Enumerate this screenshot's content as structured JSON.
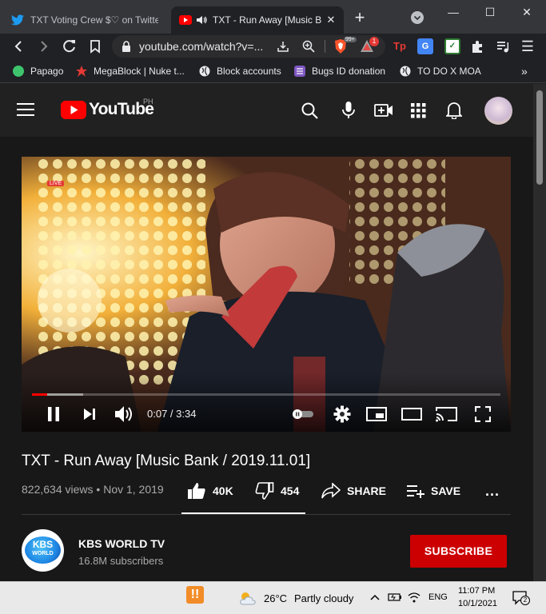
{
  "browser": {
    "tabs": [
      {
        "title": "TXT Voting Crew $♡ on Twitter: \"",
        "active": false
      },
      {
        "title": "TXT - Run Away [Music Bank",
        "active": true
      }
    ],
    "url": "youtube.com/watch?v=...",
    "extension_badge": "1",
    "brave_badge": "99+",
    "bookmarks": [
      {
        "label": "Papago",
        "icon": "papago-icon",
        "color": "#3ec46d"
      },
      {
        "label": "MegaBlock | Nuke t...",
        "icon": "megablock-icon",
        "color": "#e53935"
      },
      {
        "label": "Block accounts",
        "icon": "globe-icon",
        "color": "#e8eaed"
      },
      {
        "label": "Bugs ID donation",
        "icon": "list-icon",
        "color": "#7e57c2"
      },
      {
        "label": "TO DO X MOA",
        "icon": "globe-icon",
        "color": "#e8eaed"
      }
    ],
    "more_bookmarks": "»"
  },
  "youtube": {
    "logo_text": "YouTube",
    "region": "PH",
    "player": {
      "current_time": "0:07",
      "duration": "3:34",
      "time_separator": " / ",
      "progress_fraction": 0.033,
      "buffered_fraction": 0.11,
      "live_badge": "LIVE"
    },
    "video": {
      "title": "TXT - Run Away [Music Bank / 2019.11.01]",
      "views": "822,634 views",
      "date": "Nov 1, 2019",
      "likes": "40K",
      "dislikes": "454",
      "share_label": "SHARE",
      "save_label": "SAVE",
      "more_label": "..."
    },
    "channel": {
      "name": "KBS WORLD TV",
      "subscribers": "16.8M subscribers",
      "logo_text_top": "KBS",
      "logo_text_bottom": "WORLD",
      "subscribe_label": "SUBSCRIBE"
    }
  },
  "taskbar": {
    "temperature": "26°C",
    "weather": "Partly cloudy",
    "language": "ENG",
    "time": "11:07 PM",
    "date": "10/1/2021",
    "notifications": "2"
  },
  "colors": {
    "youtube_red": "#ff0000",
    "subscribe_red": "#cc0000",
    "page_bg": "#181818",
    "header_bg": "#212121"
  }
}
